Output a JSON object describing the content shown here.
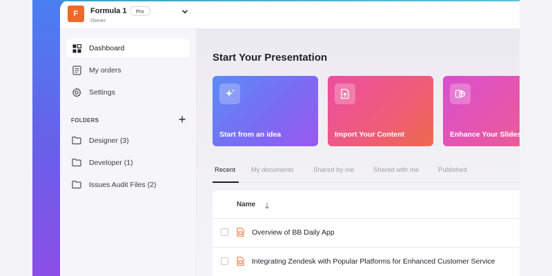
{
  "workspace": {
    "avatar_letter": "F",
    "name": "Formula 1",
    "role": "Owner",
    "plan_badge": "Pro",
    "avatar_color": "#ee6a2a"
  },
  "sidebar": {
    "items": [
      {
        "label": "Dashboard",
        "icon": "dashboard-grid-icon",
        "active": true
      },
      {
        "label": "My orders",
        "icon": "orders-document-icon",
        "active": false
      },
      {
        "label": "Settings",
        "icon": "gear-icon",
        "active": false
      }
    ],
    "folders_label": "FOLDERS",
    "folders": [
      {
        "label": "Designer (3)",
        "icon": "folder-icon"
      },
      {
        "label": "Developer (1)",
        "icon": "folder-icon"
      },
      {
        "label": "Issues Audit Files (2)",
        "icon": "folder-icon"
      }
    ]
  },
  "main": {
    "title": "Start Your Presentation",
    "cards": [
      {
        "label": "Start from an idea",
        "icon": "sparkle-icon"
      },
      {
        "label": "Import Your Content",
        "icon": "import-file-icon"
      },
      {
        "label": "Enhance Your Slides",
        "icon": "presentation-icon"
      }
    ],
    "tabs": [
      {
        "label": "Recent",
        "active": true
      },
      {
        "label": "My documents",
        "active": false
      },
      {
        "label": "Shared by me",
        "active": false
      },
      {
        "label": "Shared with me",
        "active": false
      },
      {
        "label": "Published",
        "active": false
      }
    ],
    "table": {
      "column_name": "Name",
      "rows": [
        {
          "title": "Overview of BB Daily App",
          "icon": "presentation-file-icon"
        },
        {
          "title": "Integrating Zendesk with Popular Platforms for Enhanced Customer Service",
          "icon": "presentation-file-icon"
        }
      ]
    }
  },
  "colors": {
    "accent_gradient_start": "#4a7ff0",
    "accent_gradient_end": "#8a4fe6",
    "file_icon": "#ee6a2a"
  }
}
